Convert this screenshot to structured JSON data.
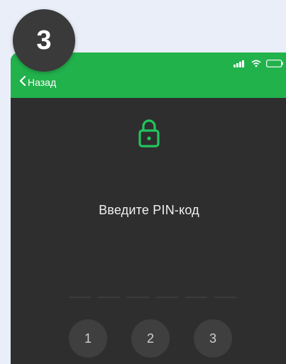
{
  "step_badge": "3",
  "header": {
    "back_label": "Назад",
    "color": "#22b24c"
  },
  "status_bar": {
    "icons": [
      "signal-icon",
      "wifi-icon",
      "battery-icon"
    ]
  },
  "lock": {
    "icon": "lock-icon",
    "color": "#22c55e"
  },
  "pin": {
    "prompt": "Введите PIN-код",
    "length": 6
  },
  "keypad": {
    "keys": [
      "1",
      "2",
      "3"
    ]
  },
  "colors": {
    "background": "#2e2e2e",
    "accent": "#22b24c",
    "key": "#3f3f3f"
  }
}
